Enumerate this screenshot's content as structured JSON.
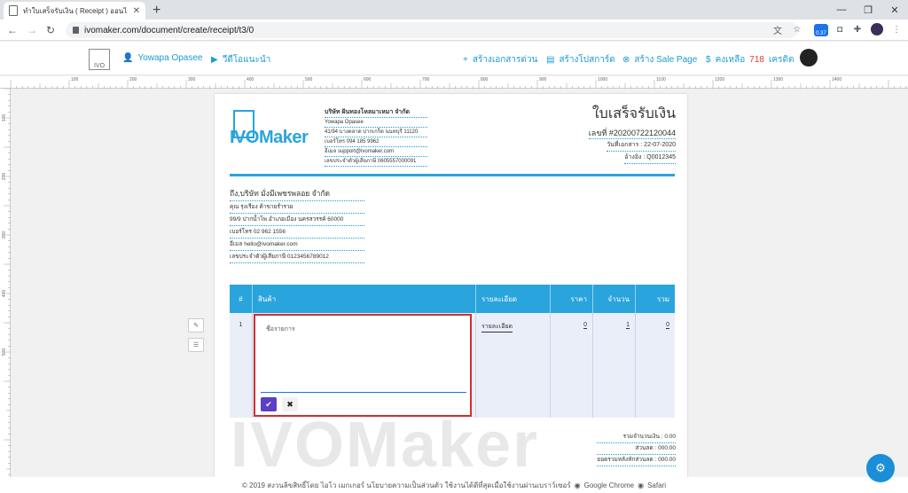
{
  "browser": {
    "tab_title": "ทำใบเสร็จรับเงิน ( Receipt ) ออนไลน์",
    "url": "ivomaker.com/document/create/receipt/t3/0",
    "extension_badge": "0.37"
  },
  "appbar": {
    "logo_text": "IVO",
    "user_name": "Yowapa Opasee",
    "video_label": "วีดีโอแนะนำ",
    "quick_doc_label": "สร้างเอกสารด่วน",
    "postcard_label": "สร้างโปสการ์ด",
    "sale_page_label": "สร้าง Sale Page",
    "credit_prefix": "คงเหลือ",
    "credit_amount": "718",
    "credit_suffix": "เครดิต"
  },
  "ruler": {
    "h_labels": [
      "100",
      "200",
      "300",
      "400",
      "500",
      "600",
      "700",
      "800",
      "900",
      "1000",
      "1100",
      "1200",
      "1300",
      "1400"
    ],
    "v_labels": [
      "100",
      "200",
      "300",
      "400",
      "500"
    ]
  },
  "company": {
    "logo_text": "IVOMaker",
    "name": "บริษัท ฝันทองโหลมาเหมา จำกัด",
    "contact": "Yowapa Opasee",
    "address": "41/94 บางตลาด ปากเกร็ด นนทบุรี 11120",
    "phone": "เบอร์โทร 094 185 9962",
    "email": "อีเมล support@ivomaker.com",
    "tax_id": "เลขประจำตัวผู้เสียภาษี 0605557000091"
  },
  "document": {
    "title": "ใบเสร็จรับเงิน",
    "number": "เลขที่ #20200722120044",
    "date": "วันที่เอกสาร : 22-07-2020",
    "reference": "อ้างอิง : Q0012345"
  },
  "customer": {
    "name": "ถึง,บริษัท มั่งมีเพชรพลอย จำกัด",
    "contact": "คุณ รุ่งเรือง ค้าขายร่ำรวย",
    "address": "99/9 ปากน้ำโพ อำเภอเมือง นครสวรรค์ 60000",
    "phone": "เบอร์โทร 02 962 1556",
    "email": "อีเมล hello@ivomaker.com",
    "tax_id": "เลขประจำตัวผู้เสียภาษี 0123456789012"
  },
  "table": {
    "headers": [
      "#",
      "สินค้า",
      "รายละเอียด",
      "ราคา",
      "จำนวน",
      "รวม"
    ],
    "rows": [
      {
        "no": "1",
        "product": "ชื่อรายการ",
        "description": "รายละเอียด",
        "price": "0",
        "qty": "1",
        "total": "0"
      }
    ]
  },
  "editor": {
    "placeholder": "ชื่อรายการ"
  },
  "totals": {
    "subtotal": "รวมจำนวนเงิน : 0.00",
    "discount": "ส่วนลด : 000.00",
    "after_discount": "ยอดรวมหลังหักส่วนลด : 000.00"
  },
  "watermark": "IVOMaker",
  "footer": {
    "text": "© 2019 สงวนลิขสิทธิ์โดย ไอโว เมกเกอร์ นโยบายความเป็นส่วนตัว ใช้งานได้ดีที่สุดเมื่อใช้งานผ่านเบราว์เซอร์",
    "chrome": "Google Chrome",
    "safari": "Safari"
  }
}
